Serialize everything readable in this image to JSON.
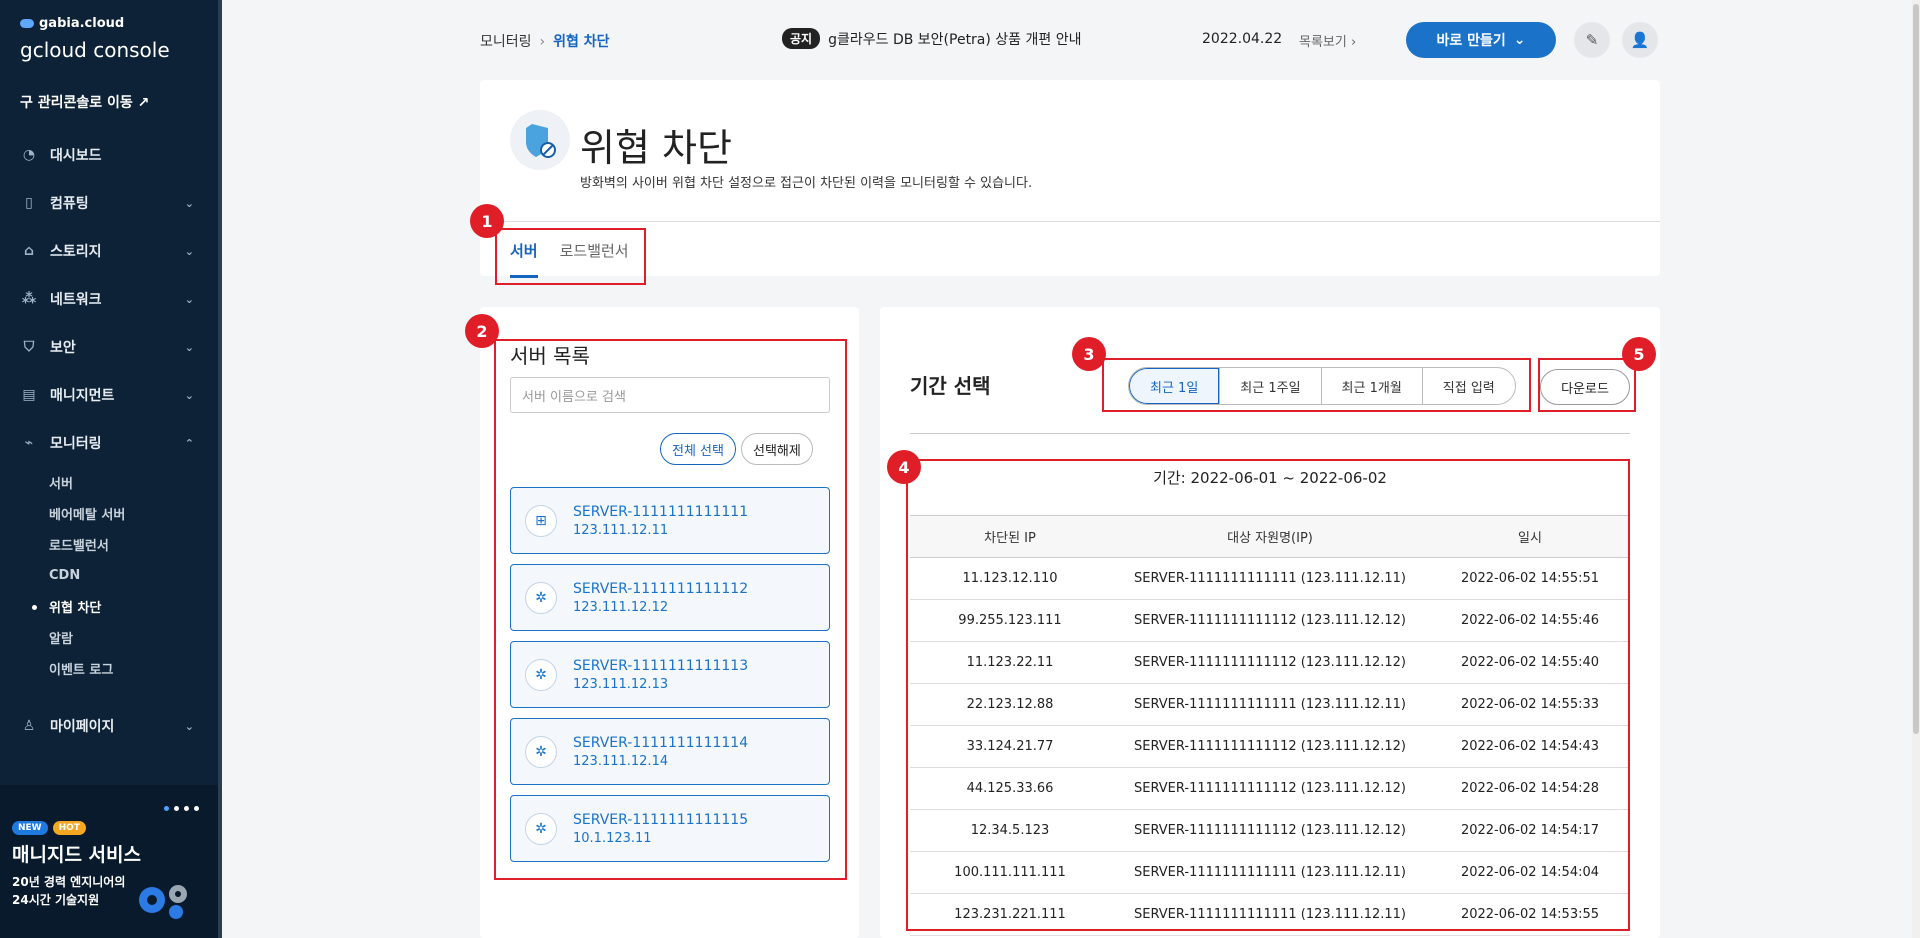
{
  "brand": {
    "small": "gabia.cloud",
    "big": "gcloud console",
    "old_console": "구 관리콘솔로 이동"
  },
  "nav": [
    {
      "label": "대시보드",
      "icon": "dashboard-icon",
      "glyph": "◔"
    },
    {
      "label": "컴퓨팅",
      "icon": "chip-icon",
      "glyph": "▯"
    },
    {
      "label": "스토리지",
      "icon": "storage-icon",
      "glyph": "⌂"
    },
    {
      "label": "네트워크",
      "icon": "network-icon",
      "glyph": "⁂"
    },
    {
      "label": "보안",
      "icon": "shield-icon",
      "glyph": "⛉"
    },
    {
      "label": "매니지먼트",
      "icon": "management-icon",
      "glyph": "▤"
    }
  ],
  "monitoring": {
    "label": "모니터링",
    "items": [
      "서버",
      "베어메탈 서버",
      "로드밸런서",
      "CDN",
      "위협 차단",
      "알람",
      "이벤트 로그"
    ]
  },
  "mypage": "마이페이지",
  "promo": {
    "new": "NEW",
    "hot": "HOT",
    "title": "매니지드 서비스",
    "line1": "20년 경력 엔지니어의",
    "line2": "24시간 기술지원"
  },
  "topbar": {
    "crumb_root": "모니터링",
    "crumb_current": "위협 차단",
    "notice_tag": "공지",
    "notice_text": "g클라우드 DB 보안(Petra) 상품 개편 안내",
    "notice_date": "2022.04.22",
    "notice_list": "목록보기",
    "make_button": "바로 만들기"
  },
  "page": {
    "title": "위협 차단",
    "description": "방화벽의 사이버 위협 차단 설정으로 접근이 차단된 이력을 모니터링할 수 있습니다.",
    "tabs": [
      "서버",
      "로드밸런서"
    ]
  },
  "server_panel": {
    "title": "서버 목록",
    "search_placeholder": "서버 이름으로 검색",
    "select_all": "전체 선택",
    "deselect": "선택해제",
    "servers": [
      {
        "name": "SERVER-1111111111111",
        "ip": "123.111.12.11",
        "os": "windows-icon"
      },
      {
        "name": "SERVER-1111111111112",
        "ip": "123.111.12.12",
        "os": "linux-icon"
      },
      {
        "name": "SERVER-1111111111113",
        "ip": "123.111.12.13",
        "os": "linux-icon"
      },
      {
        "name": "SERVER-1111111111114",
        "ip": "123.111.12.14",
        "os": "linux-icon"
      },
      {
        "name": "SERVER-1111111111115",
        "ip": "10.1.123.11",
        "os": "linux-icon"
      }
    ]
  },
  "period_panel": {
    "title": "기간 선택",
    "ranges": [
      "최근 1일",
      "최근 1주일",
      "최근 1개월",
      "직접 입력"
    ],
    "download": "다운로드",
    "period_text": "기간: 2022-06-01 ~ 2022-06-02",
    "columns": [
      "차단된 IP",
      "대상 자원명(IP)",
      "일시"
    ],
    "rows": [
      [
        "11.123.12.110",
        "SERVER-1111111111111 (123.111.12.11)",
        "2022-06-02 14:55:51"
      ],
      [
        "99.255.123.111",
        "SERVER-1111111111112 (123.111.12.12)",
        "2022-06-02 14:55:46"
      ],
      [
        "11.123.22.11",
        "SERVER-1111111111112 (123.111.12.12)",
        "2022-06-02 14:55:40"
      ],
      [
        "22.123.12.88",
        "SERVER-1111111111111 (123.111.12.11)",
        "2022-06-02 14:55:33"
      ],
      [
        "33.124.21.77",
        "SERVER-1111111111112 (123.111.12.12)",
        "2022-06-02 14:54:43"
      ],
      [
        "44.125.33.66",
        "SERVER-1111111111112 (123.111.12.12)",
        "2022-06-02 14:54:28"
      ],
      [
        "12.34.5.123",
        "SERVER-1111111111112 (123.111.12.12)",
        "2022-06-02 14:54:17"
      ],
      [
        "100.111.111.111",
        "SERVER-1111111111111 (123.111.12.11)",
        "2022-06-02 14:54:04"
      ],
      [
        "123.231.221.111",
        "SERVER-1111111111111 (123.111.12.11)",
        "2022-06-02 14:53:55"
      ]
    ]
  },
  "callouts": [
    "1",
    "2",
    "3",
    "4",
    "5"
  ]
}
